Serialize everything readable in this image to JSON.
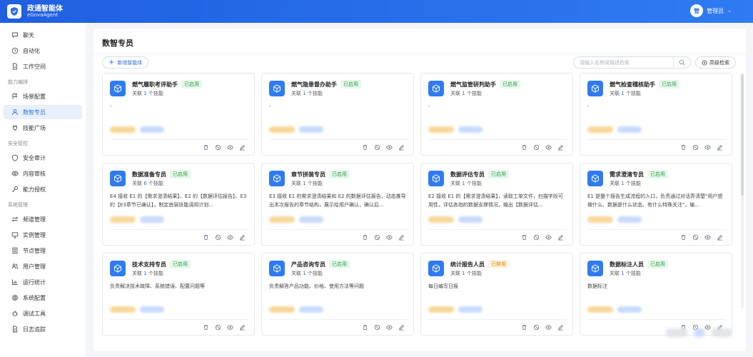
{
  "header": {
    "title": "政通智能体",
    "subtitle": "eGovaAgent",
    "user_avatar": "管",
    "user_name": "管理员",
    "brand_color": "#2f6fe8"
  },
  "sidebar": {
    "items_top": [
      {
        "label": "聊天",
        "icon": "chat-icon"
      },
      {
        "label": "自动化",
        "icon": "clock-icon"
      },
      {
        "label": "工作空间",
        "icon": "document-icon"
      }
    ],
    "section1": "能力编排",
    "items_s1": [
      {
        "label": "场景配置",
        "icon": "flag-icon"
      },
      {
        "label": "数智专员",
        "icon": "user-icon",
        "active": true
      },
      {
        "label": "技能广场",
        "icon": "plug-icon"
      }
    ],
    "section2": "安全管控",
    "items_s2": [
      {
        "label": "安全审计",
        "icon": "shield-icon"
      },
      {
        "label": "内容审核",
        "icon": "eye-icon"
      },
      {
        "label": "能力授权",
        "icon": "key-icon"
      }
    ],
    "section3": "系统管理",
    "items_s3": [
      {
        "label": "频道管理",
        "icon": "arrows-icon"
      },
      {
        "label": "实例管理",
        "icon": "monitor-icon"
      },
      {
        "label": "节点管理",
        "icon": "server-icon"
      },
      {
        "label": "用户管理",
        "icon": "users-icon"
      },
      {
        "label": "运行统计",
        "icon": "chart-icon"
      },
      {
        "label": "系统配置",
        "icon": "gear-icon"
      },
      {
        "label": "调试工具",
        "icon": "bug-icon"
      },
      {
        "label": "日志追踪",
        "icon": "log-icon"
      }
    ]
  },
  "main": {
    "title": "数智专员",
    "add_label": "新增智能体",
    "search_placeholder": "请输入名称或描述检索",
    "advanced_label": "高级检索",
    "rel_prefix": "关联",
    "rel_suffix": "个技能",
    "cards": [
      {
        "name": "燃气履职考评助手",
        "status": "已启用",
        "skills": "1",
        "desc": "-"
      },
      {
        "name": "燃气隐患督办助手",
        "status": "已启用",
        "skills": "1",
        "desc": "-"
      },
      {
        "name": "燃气监管研判助手",
        "status": "已启用",
        "skills": "1",
        "desc": "-"
      },
      {
        "name": "燃气检查稽核助手",
        "status": "已启用",
        "skills": "1",
        "desc": "-"
      },
      {
        "name": "数据准备专员",
        "status": "已启用",
        "skills": "6",
        "desc": "E4 接收 E1 的【需求澄清结果】、E2 的【数据评估报告】、E3 的【E3章节已确认】，制定底层技能调用计划..."
      },
      {
        "name": "章节拼装专员",
        "status": "已启用",
        "skills": "1",
        "desc": "E3 接收 E1 的需求澄清结果和 E2 的数据评估报告，动态推导出本次报告的章节结构，展示给用户确认，确认后..."
      },
      {
        "name": "数据评估专员",
        "status": "已启用",
        "skills": "1",
        "desc": "E2 接收 E1 的【需求澄清结果】，读取工单文件，扫描字段可用性，评估各指的数据支撑情况，输出【数据评估..."
      },
      {
        "name": "需求澄清专员",
        "status": "已启用",
        "skills": "1",
        "desc": "E1 是整个报告生成流程的入口，负责通过对话弄清楚\"用户想做什么、数据是什么状态、有什么特殊关注\"，输..."
      },
      {
        "name": "技术支持专员",
        "status": "已启用",
        "skills": "1",
        "desc": "负责解决技术故障、系统错误、配置问题等"
      },
      {
        "name": "产品咨询专员",
        "status": "已启用",
        "skills": "1",
        "desc": "负责解答产品功能、价格、使用方法等问题"
      },
      {
        "name": "统计报告人员",
        "status": "已禁用",
        "skills": "1",
        "desc": "每日编写日报"
      },
      {
        "name": "数据标注人员",
        "status": "已启用",
        "skills": "1",
        "desc": "数据标注"
      }
    ]
  }
}
